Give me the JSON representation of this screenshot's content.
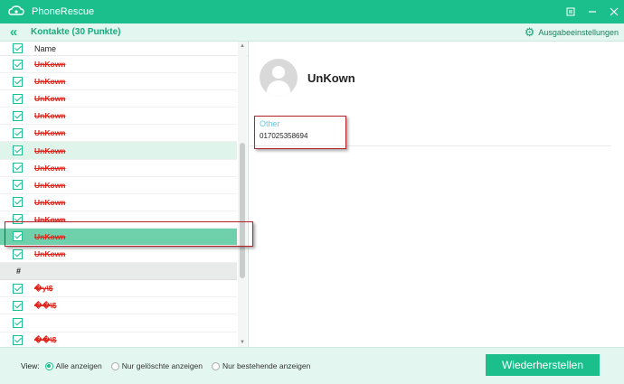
{
  "window": {
    "title": "PhoneRescue",
    "controls": [
      "menu-icon",
      "minimize-icon",
      "close-icon"
    ]
  },
  "subheader": {
    "title": "Kontakte (30 Punkte)",
    "settings_label": "Ausgabeeinstellungen"
  },
  "list": {
    "column_name": "Name",
    "rows": [
      {
        "type": "item",
        "name": "UnKown",
        "checked": true,
        "state": "normal"
      },
      {
        "type": "item",
        "name": "UnKown",
        "checked": true,
        "state": "normal"
      },
      {
        "type": "item",
        "name": "UnKown",
        "checked": true,
        "state": "normal"
      },
      {
        "type": "item",
        "name": "UnKown",
        "checked": true,
        "state": "normal"
      },
      {
        "type": "item",
        "name": "UnKown",
        "checked": true,
        "state": "normal"
      },
      {
        "type": "item",
        "name": "UnKown",
        "checked": true,
        "state": "hover"
      },
      {
        "type": "item",
        "name": "UnKown",
        "checked": true,
        "state": "normal"
      },
      {
        "type": "item",
        "name": "UnKown",
        "checked": true,
        "state": "normal"
      },
      {
        "type": "item",
        "name": "UnKown",
        "checked": true,
        "state": "normal"
      },
      {
        "type": "item",
        "name": "UnKown",
        "checked": true,
        "state": "normal"
      },
      {
        "type": "item",
        "name": "UnKown",
        "checked": true,
        "state": "active"
      },
      {
        "type": "item",
        "name": "UnKown",
        "checked": true,
        "state": "normal"
      },
      {
        "type": "group",
        "name": "#"
      },
      {
        "type": "item",
        "name": "�y\\$",
        "checked": true,
        "state": "normal"
      },
      {
        "type": "item",
        "name": "��\\$",
        "checked": true,
        "state": "normal"
      },
      {
        "type": "item",
        "name": "",
        "checked": true,
        "state": "normal"
      },
      {
        "type": "item",
        "name": "��\\$",
        "checked": true,
        "state": "normal"
      }
    ]
  },
  "detail": {
    "name": "UnKown",
    "field_label": "Other",
    "field_value": "017025358694"
  },
  "footer": {
    "view_label": "View:",
    "options": [
      {
        "label": "Alle anzeigen",
        "selected": true
      },
      {
        "label": "Nur gelöschte anzeigen",
        "selected": false
      },
      {
        "label": "Nur bestehende anzeigen",
        "selected": false
      }
    ],
    "restore_label": "Wiederherstellen"
  },
  "colors": {
    "accent": "#1bbf8c",
    "deleted_text": "#e0241b",
    "highlight_box": "#b5202a"
  }
}
